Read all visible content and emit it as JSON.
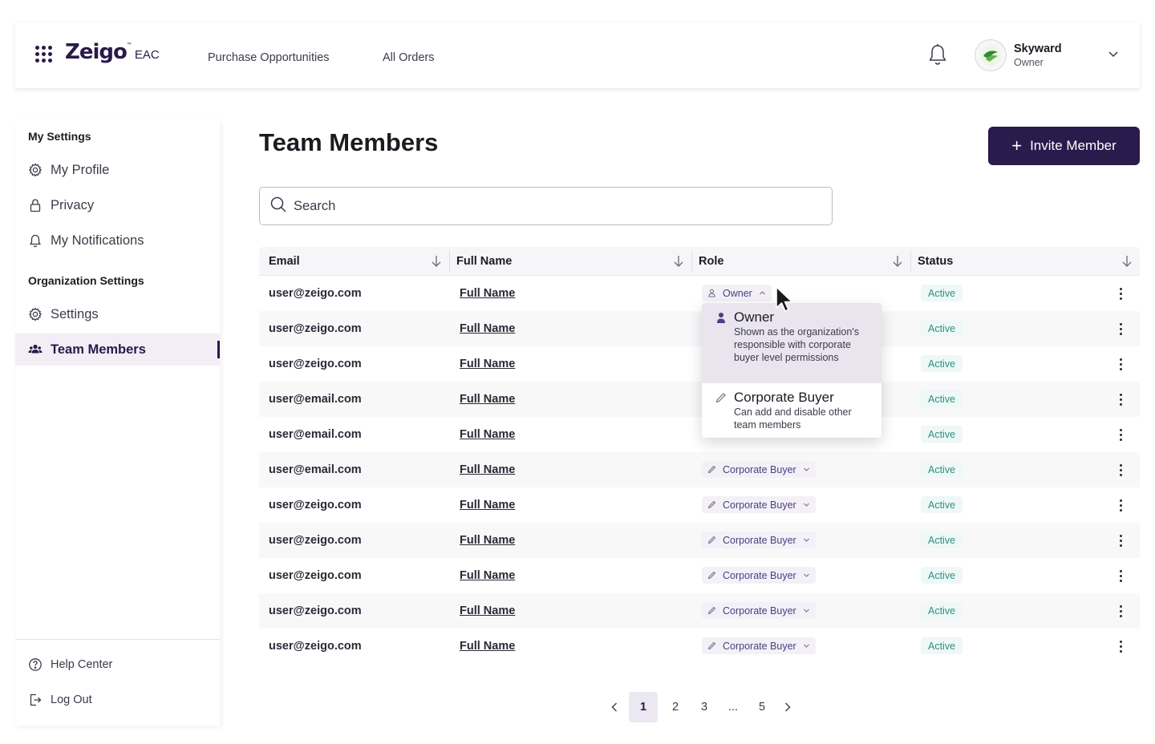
{
  "header": {
    "logo": {
      "word": "Zeigo",
      "tm": "™",
      "suffix": "EAC"
    },
    "nav": [
      "Purchase Opportunities",
      "All Orders"
    ],
    "user": {
      "name": "Skyward",
      "role": "Owner"
    },
    "icons": {
      "apps": "grid-dots-icon",
      "notifications": "bell-icon",
      "menu": "chevron-down-icon"
    }
  },
  "sidebar": {
    "my_settings_heading": "My Settings",
    "my_settings": [
      {
        "label": "My Profile",
        "icon": "gear-icon"
      },
      {
        "label": "Privacy",
        "icon": "lock-icon"
      },
      {
        "label": "My Notifications",
        "icon": "bell-icon"
      }
    ],
    "org_heading": "Organization Settings",
    "org_settings": [
      {
        "label": "Settings",
        "icon": "gear-icon"
      },
      {
        "label": "Team Members",
        "icon": "people-icon",
        "active": true
      }
    ],
    "footer": [
      {
        "label": "Help Center",
        "icon": "question-icon"
      },
      {
        "label": "Log Out",
        "icon": "logout-icon"
      }
    ]
  },
  "main": {
    "title": "Team Members",
    "invite_button": "Invite Member",
    "search_placeholder": "Search",
    "table": {
      "columns": [
        "Email",
        "Full Name",
        "Role",
        "Status"
      ],
      "rows": [
        {
          "email": "user@zeigo.com",
          "name": "Full Name",
          "role": "Owner",
          "status": "Active"
        },
        {
          "email": "user@zeigo.com",
          "name": "Full Name",
          "role": "",
          "status": "Active"
        },
        {
          "email": "user@zeigo.com",
          "name": "Full Name",
          "role": "",
          "status": "Active"
        },
        {
          "email": "user@email.com",
          "name": "Full Name",
          "role": "",
          "status": "Active"
        },
        {
          "email": "user@email.com",
          "name": "Full Name",
          "role": "",
          "status": "Active"
        },
        {
          "email": "user@email.com",
          "name": "Full Name",
          "role": "Corporate Buyer",
          "status": "Active"
        },
        {
          "email": "user@zeigo.com",
          "name": "Full Name",
          "role": "Corporate Buyer",
          "status": "Active"
        },
        {
          "email": "user@zeigo.com",
          "name": "Full Name",
          "role": "Corporate Buyer",
          "status": "Active"
        },
        {
          "email": "user@zeigo.com",
          "name": "Full Name",
          "role": "Corporate Buyer",
          "status": "Active"
        },
        {
          "email": "user@zeigo.com",
          "name": "Full Name",
          "role": "Corporate Buyer",
          "status": "Active"
        },
        {
          "email": "user@zeigo.com",
          "name": "Full Name",
          "role": "Corporate Buyer",
          "status": "Active"
        }
      ]
    },
    "role_dropdown": {
      "options": [
        {
          "title": "Owner",
          "description": "Shown as the organization's responsible with corporate buyer level permissions",
          "icon": "person-icon",
          "selected": true
        },
        {
          "title": "Corporate Buyer",
          "description": "Can add and disable other team members",
          "icon": "pencil-icon",
          "selected": false
        }
      ]
    },
    "pagination": {
      "pages": [
        "1",
        "2",
        "3",
        "...",
        "5"
      ],
      "current": "1"
    }
  },
  "colors": {
    "brand": "#2b1a4c",
    "active_status": "#2d8f7d",
    "role_text": "#4a3f80"
  }
}
